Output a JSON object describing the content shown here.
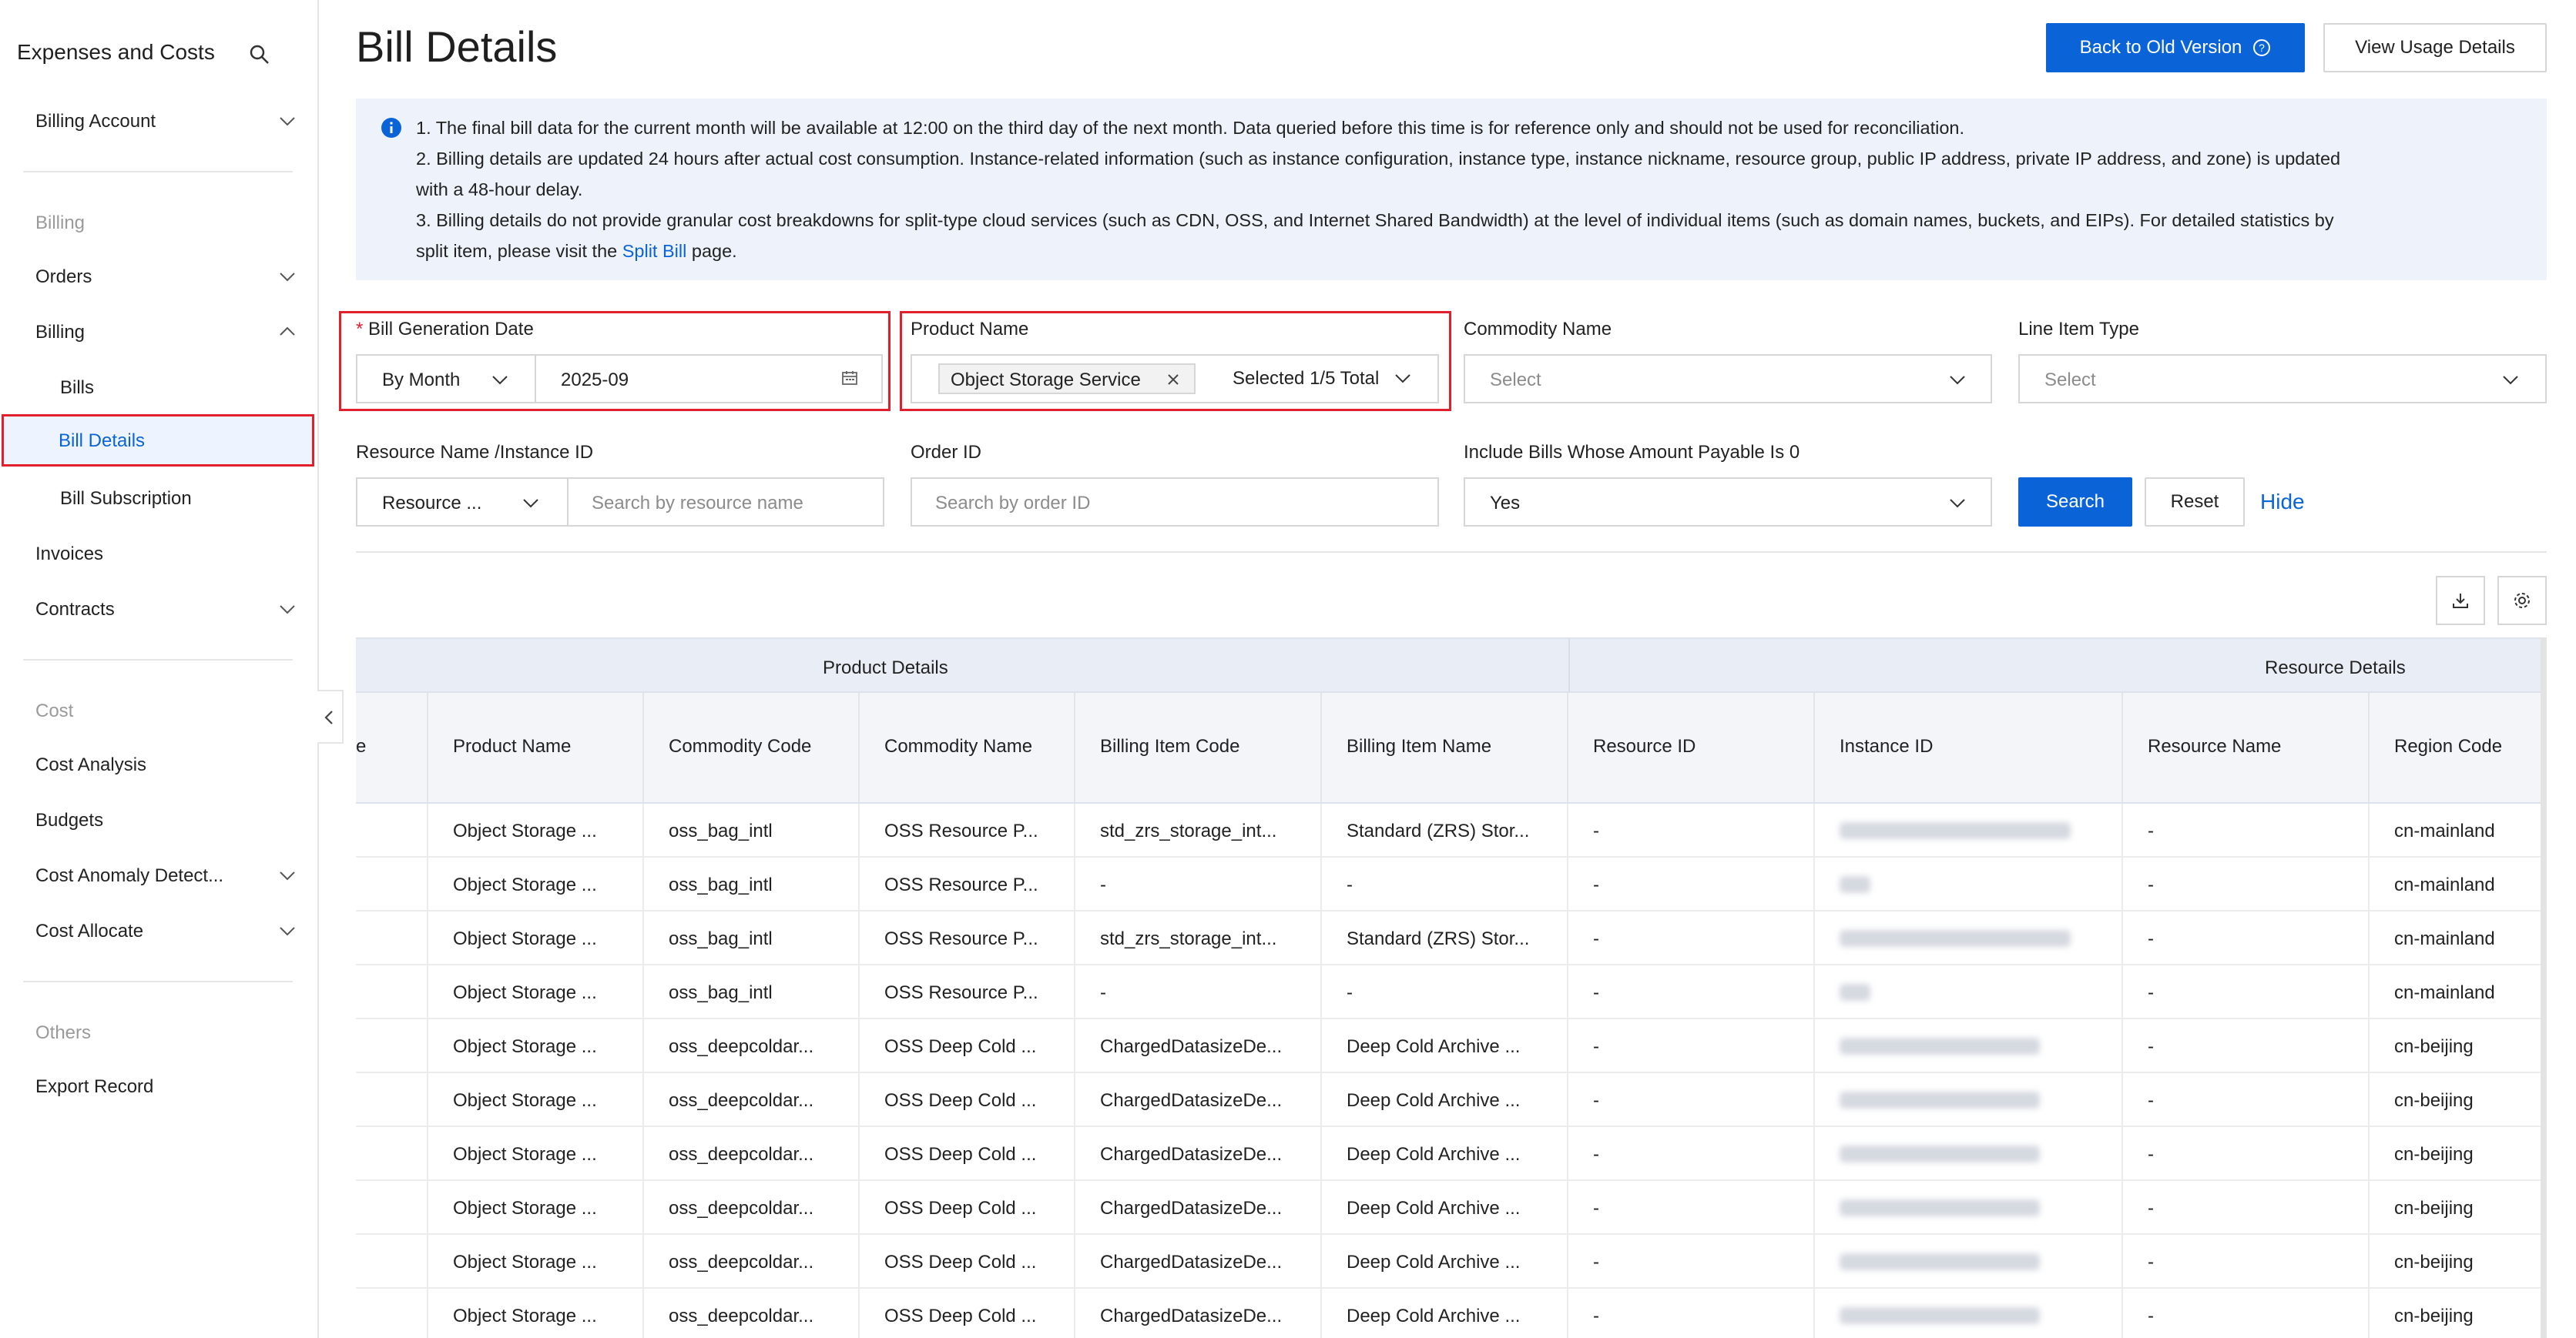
{
  "sidebar": {
    "title": "Expenses and Costs",
    "billing_account": "Billing Account",
    "section_billing": "Billing",
    "orders": "Orders",
    "billing": "Billing",
    "bills": "Bills",
    "bill_details": "Bill Details",
    "bill_subscription": "Bill Subscription",
    "invoices": "Invoices",
    "contracts": "Contracts",
    "section_cost": "Cost",
    "cost_analysis": "Cost Analysis",
    "budgets": "Budgets",
    "cost_anomaly": "Cost Anomaly Detect...",
    "cost_allocate": "Cost Allocate",
    "section_others": "Others",
    "export_record": "Export Record"
  },
  "header": {
    "title": "Bill Details",
    "back_old_version": "Back to Old Version",
    "view_usage": "View Usage Details"
  },
  "notice": {
    "line1": "1. The final bill data for the current month will be available at 12:00 on the third day of the next month. Data queried before this time is for reference only and should not be used for reconciliation.",
    "line2": "2. Billing details are updated 24 hours after actual cost consumption. Instance-related information (such as instance configuration, instance type, instance nickname, resource group, public IP address, private IP address, and zone) is updated",
    "line3": "with a 48-hour delay.",
    "line4": "3. Billing details do not provide granular cost breakdowns for split-type cloud services (such as CDN, OSS, and Internet Shared Bandwidth) at the level of individual items (such as domain names, buckets, and EIPs). For detailed statistics by",
    "line5_pre": "split item, please visit the ",
    "line5_link": "Split Bill",
    "line5_post": " page."
  },
  "filters": {
    "bill_date_label": "Bill Generation Date",
    "required_mark": "*",
    "period_type": "By Month",
    "period_value": "2025-09",
    "product_label": "Product Name",
    "product_tag": "Object Storage Service",
    "product_selected": "Selected 1/5 Total",
    "commodity_label": "Commodity Name",
    "commodity_placeholder": "Select",
    "line_item_label": "Line Item Type",
    "line_item_placeholder": "Select",
    "resource_label": "Resource Name /Instance ID",
    "resource_type": "Resource ...",
    "resource_placeholder": "Search by resource name",
    "order_label": "Order ID",
    "order_placeholder": "Search by order ID",
    "zero_label": "Include Bills Whose Amount Payable Is 0",
    "zero_value": "Yes",
    "search": "Search",
    "reset": "Reset",
    "hide": "Hide"
  },
  "table": {
    "group_product": "Product Details",
    "group_resource": "Resource Details",
    "first_col_fragment": "e",
    "columns": [
      "Product Name",
      "Commodity Code",
      "Commodity Name",
      "Billing Item Code",
      "Billing Item Name",
      "Resource ID",
      "Instance ID",
      "Resource Name",
      "Region Code"
    ],
    "rows": [
      [
        "Object Storage ...",
        "oss_bag_intl",
        "OSS Resource P...",
        "std_zrs_storage_int...",
        "Standard (ZRS) Stor...",
        "-",
        "",
        "-",
        "cn-mainland"
      ],
      [
        "Object Storage ...",
        "oss_bag_intl",
        "OSS Resource P...",
        "-",
        "-",
        "-",
        "",
        "-",
        "cn-mainland"
      ],
      [
        "Object Storage ...",
        "oss_bag_intl",
        "OSS Resource P...",
        "std_zrs_storage_int...",
        "Standard (ZRS) Stor...",
        "-",
        "",
        "-",
        "cn-mainland"
      ],
      [
        "Object Storage ...",
        "oss_bag_intl",
        "OSS Resource P...",
        "-",
        "-",
        "-",
        "",
        "-",
        "cn-mainland"
      ],
      [
        "Object Storage ...",
        "oss_deepcoldar...",
        "OSS Deep Cold ...",
        "ChargedDatasizeDe...",
        "Deep Cold Archive ...",
        "-",
        "",
        "-",
        "cn-beijing"
      ],
      [
        "Object Storage ...",
        "oss_deepcoldar...",
        "OSS Deep Cold ...",
        "ChargedDatasizeDe...",
        "Deep Cold Archive ...",
        "-",
        "",
        "-",
        "cn-beijing"
      ],
      [
        "Object Storage ...",
        "oss_deepcoldar...",
        "OSS Deep Cold ...",
        "ChargedDatasizeDe...",
        "Deep Cold Archive ...",
        "-",
        "",
        "-",
        "cn-beijing"
      ],
      [
        "Object Storage ...",
        "oss_deepcoldar...",
        "OSS Deep Cold ...",
        "ChargedDatasizeDe...",
        "Deep Cold Archive ...",
        "-",
        "",
        "-",
        "cn-beijing"
      ],
      [
        "Object Storage ...",
        "oss_deepcoldar...",
        "OSS Deep Cold ...",
        "ChargedDatasizeDe...",
        "Deep Cold Archive ...",
        "-",
        "",
        "-",
        "cn-beijing"
      ],
      [
        "Object Storage ...",
        "oss_deepcoldar...",
        "OSS Deep Cold ...",
        "ChargedDatasizeDe...",
        "Deep Cold Archive ...",
        "-",
        "",
        "-",
        "cn-beijing"
      ]
    ]
  },
  "colors": {
    "primary": "#0a64d8",
    "highlight": "#e0212d",
    "notice_bg": "#eef3fb"
  }
}
